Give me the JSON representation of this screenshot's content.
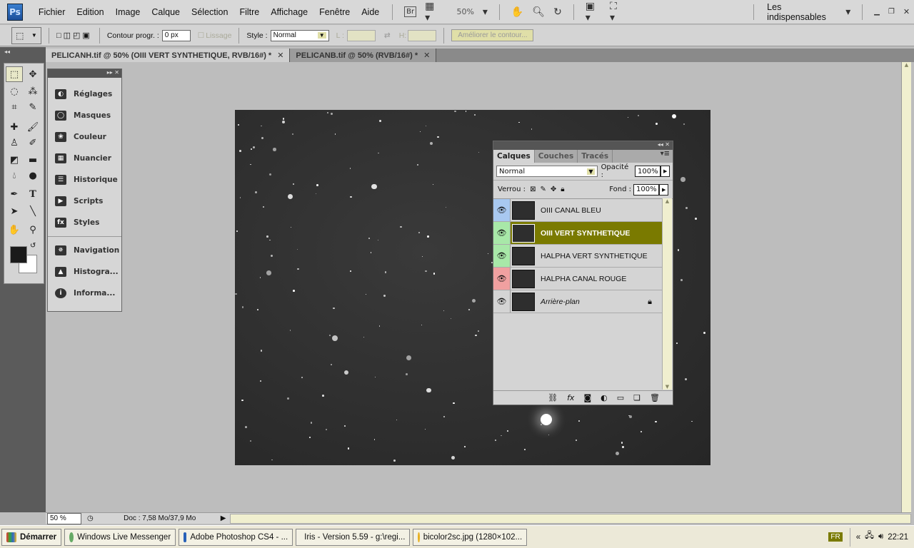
{
  "app": {
    "logo": "Ps",
    "workspace": "Les indispensables",
    "zoom": "50%"
  },
  "menu": [
    "Fichier",
    "Edition",
    "Image",
    "Calque",
    "Sélection",
    "Filtre",
    "Affichage",
    "Fenêtre",
    "Aide"
  ],
  "bridge": "Br",
  "options": {
    "feather_label": "Contour progr. :",
    "feather_value": "0 px",
    "antialias": "Lissage",
    "style_label": "Style :",
    "style_value": "Normal",
    "width_label": "L :",
    "height_label": "H:",
    "refine": "Améliorer le contour..."
  },
  "tabs": [
    {
      "label": "PELICANH.tif @ 50% (OIII VERT SYNTHETIQUE, RVB/16#) *"
    },
    {
      "label": "PELICANB.tif @ 50% (RVB/16#) *"
    }
  ],
  "dock": [
    "Réglages",
    "Masques",
    "Couleur",
    "Nuancier",
    "Historique",
    "Scripts",
    "Styles",
    "Navigation",
    "Histogra...",
    "Informa..."
  ],
  "layers_panel": {
    "tabs": [
      "Calques",
      "Couches",
      "Tracés"
    ],
    "blend": "Normal",
    "opacity_label": "Opacité :",
    "opacity": "100%",
    "lock_label": "Verrou :",
    "fill_label": "Fond :",
    "fill": "100%",
    "layers": [
      {
        "name": "OIII CANAL BLEU",
        "color": "#a8c8f0"
      },
      {
        "name": "OIII VERT SYNTHETIQUE",
        "color": "#a8e8a8",
        "selected": true
      },
      {
        "name": "HALPHA VERT SYNTHETIQUE",
        "color": "#a8e8a8"
      },
      {
        "name": "HALPHA CANAL ROUGE",
        "color": "#f0a0a0"
      },
      {
        "name": "Arrière-plan",
        "color": "#d4d4d4",
        "locked": true
      }
    ],
    "selected_color": "#7a7a00"
  },
  "status": {
    "zoom": "50 %",
    "doc": "Doc : 7,58 Mo/37,9 Mo"
  },
  "taskbar": {
    "start": "Démarrer",
    "tasks": [
      "Windows Live Messenger",
      "Adobe Photoshop CS4 - ...",
      "Iris - Version 5.59 - g:\\regi...",
      "bicolor2sc.jpg (1280×102..."
    ],
    "lang": "FR",
    "clock": "22:21"
  }
}
